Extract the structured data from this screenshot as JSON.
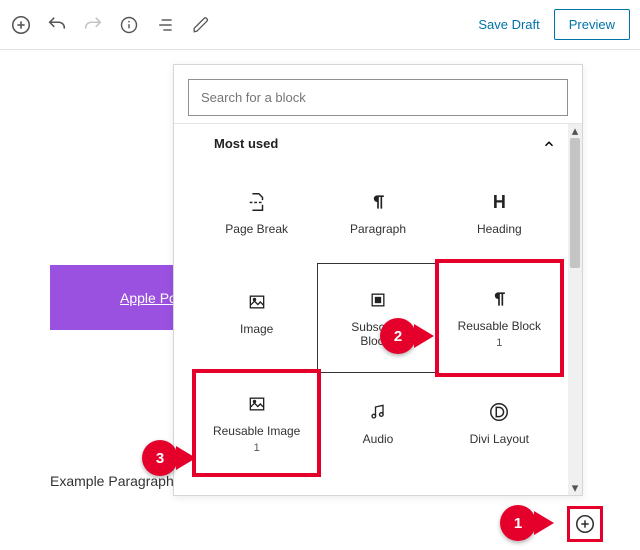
{
  "toolbar": {
    "save_draft": "Save Draft",
    "preview": "Preview"
  },
  "content": {
    "button_label": "Apple Podc",
    "paragraph": "Example Paragraph"
  },
  "inserter": {
    "search_placeholder": "Search for a block",
    "section_title": "Most used",
    "blocks": [
      {
        "label": "Page Break",
        "icon": "page-break-icon"
      },
      {
        "label": "Paragraph",
        "icon": "paragraph-icon"
      },
      {
        "label": "Heading",
        "icon": "heading-icon"
      },
      {
        "label": "Image",
        "icon": "image-icon"
      },
      {
        "label": "Subscribe Blocks",
        "icon": "subscribe-icon"
      },
      {
        "label": "Reusable Block",
        "sub": "1",
        "icon": "paragraph-icon"
      },
      {
        "label": "Reusable Image",
        "sub": "1",
        "icon": "image-icon"
      },
      {
        "label": "Audio",
        "icon": "audio-icon"
      },
      {
        "label": "Divi Layout",
        "icon": "divi-icon"
      }
    ]
  },
  "callouts": {
    "c1": "1",
    "c2": "2",
    "c3": "3"
  }
}
